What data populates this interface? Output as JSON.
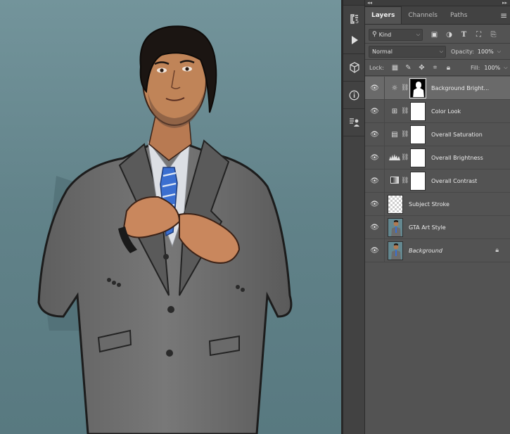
{
  "panel": {
    "tabs": [
      {
        "label": "Layers",
        "active": true
      },
      {
        "label": "Channels",
        "active": false
      },
      {
        "label": "Paths",
        "active": false
      }
    ],
    "filter": {
      "label": "Kind",
      "icon": "search-icon"
    },
    "blend_mode": "Normal",
    "opacity_label": "Opacity:",
    "opacity_value": "100%",
    "lock_label": "Lock:",
    "fill_label": "Fill:",
    "fill_value": "100%",
    "layers": [
      {
        "name": "Background Bright...",
        "type": "adjustment",
        "icon": "brightness-icon",
        "selected": true,
        "visible": true
      },
      {
        "name": "Color Look",
        "type": "adjustment",
        "icon": "color-lookup-icon",
        "selected": false,
        "visible": true
      },
      {
        "name": "Overall Saturation",
        "type": "adjustment",
        "icon": "hue-saturation-icon",
        "selected": false,
        "visible": true
      },
      {
        "name": "Overall Brightness",
        "type": "adjustment",
        "icon": "levels-icon",
        "selected": false,
        "visible": true
      },
      {
        "name": "Overall Contrast",
        "type": "adjustment",
        "icon": "gradient-map-icon",
        "selected": false,
        "visible": true
      },
      {
        "name": "Subject Stroke",
        "type": "pixel",
        "icon": "",
        "selected": false,
        "visible": true
      },
      {
        "name": "GTA Art Style",
        "type": "pixel",
        "icon": "",
        "selected": false,
        "visible": true
      },
      {
        "name": "Background",
        "type": "background",
        "icon": "lock-icon",
        "selected": false,
        "visible": true,
        "locked": true
      }
    ]
  },
  "colors": {
    "panel_bg": "#535353",
    "selected_row": "#6a6a6a",
    "canvas_wall": "#5e8088"
  }
}
